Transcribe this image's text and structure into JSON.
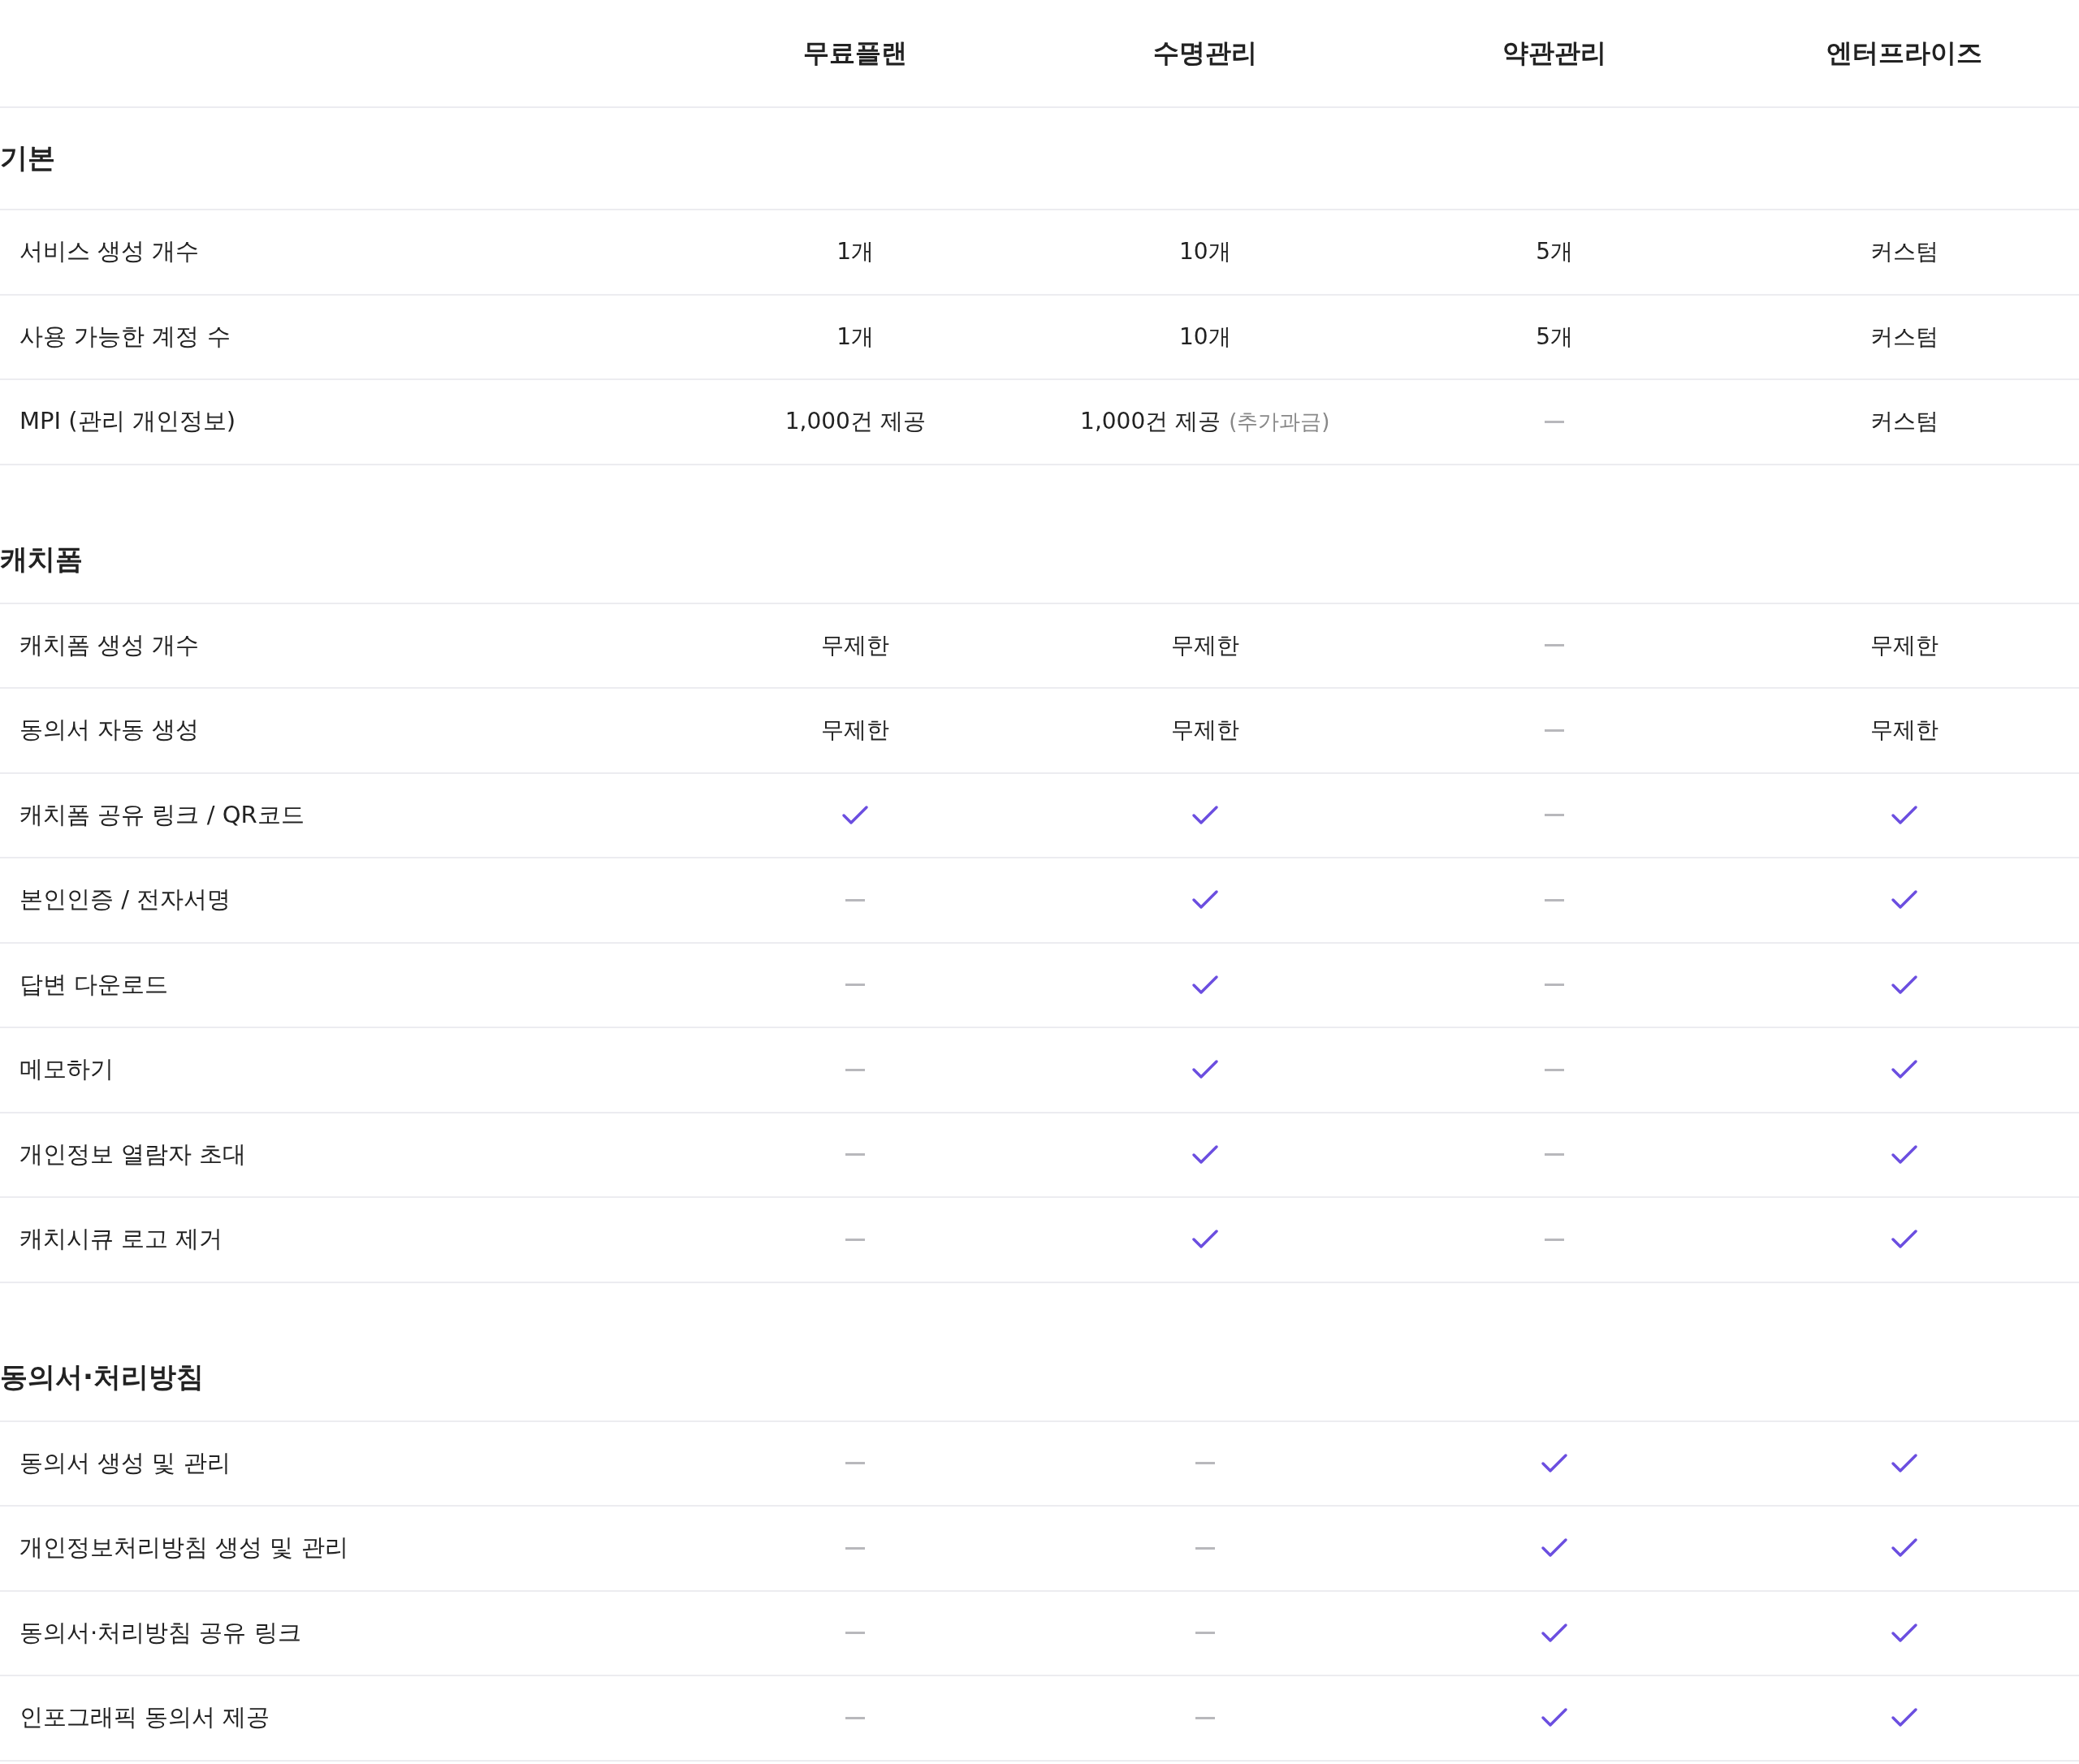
{
  "plans": [
    "무료플랜",
    "수명관리",
    "약관관리",
    "엔터프라이즈"
  ],
  "sections": [
    {
      "title": "기본",
      "rows": [
        {
          "label": "서비스 생성 개수",
          "cells": [
            {
              "kind": "text",
              "text": "1개"
            },
            {
              "kind": "text",
              "text": "10개"
            },
            {
              "kind": "text",
              "text": "5개"
            },
            {
              "kind": "text",
              "text": "커스텀"
            }
          ]
        },
        {
          "label": "사용 가능한 계정 수",
          "cells": [
            {
              "kind": "text",
              "text": "1개"
            },
            {
              "kind": "text",
              "text": "10개"
            },
            {
              "kind": "text",
              "text": "5개"
            },
            {
              "kind": "text",
              "text": "커스텀"
            }
          ]
        },
        {
          "label": "MPI (관리 개인정보)",
          "cells": [
            {
              "kind": "text",
              "text": "1,000건 제공"
            },
            {
              "kind": "text",
              "text": "1,000건 제공",
              "note": "(추가과금)"
            },
            {
              "kind": "dash"
            },
            {
              "kind": "text",
              "text": "커스텀"
            }
          ]
        }
      ]
    },
    {
      "title": "캐치폼",
      "rows": [
        {
          "label": "캐치폼 생성 개수",
          "cells": [
            {
              "kind": "text",
              "text": "무제한"
            },
            {
              "kind": "text",
              "text": "무제한"
            },
            {
              "kind": "dash"
            },
            {
              "kind": "text",
              "text": "무제한"
            }
          ]
        },
        {
          "label": "동의서 자동 생성",
          "cells": [
            {
              "kind": "text",
              "text": "무제한"
            },
            {
              "kind": "text",
              "text": "무제한"
            },
            {
              "kind": "dash"
            },
            {
              "kind": "text",
              "text": "무제한"
            }
          ]
        },
        {
          "label": "캐치폼 공유 링크 / QR코드",
          "cells": [
            {
              "kind": "check"
            },
            {
              "kind": "check"
            },
            {
              "kind": "dash"
            },
            {
              "kind": "check"
            }
          ]
        },
        {
          "label": "본인인증 / 전자서명",
          "cells": [
            {
              "kind": "dash"
            },
            {
              "kind": "check"
            },
            {
              "kind": "dash"
            },
            {
              "kind": "check"
            }
          ]
        },
        {
          "label": "답변 다운로드",
          "cells": [
            {
              "kind": "dash"
            },
            {
              "kind": "check"
            },
            {
              "kind": "dash"
            },
            {
              "kind": "check"
            }
          ]
        },
        {
          "label": "메모하기",
          "cells": [
            {
              "kind": "dash"
            },
            {
              "kind": "check"
            },
            {
              "kind": "dash"
            },
            {
              "kind": "check"
            }
          ]
        },
        {
          "label": "개인정보 열람자 초대",
          "cells": [
            {
              "kind": "dash"
            },
            {
              "kind": "check"
            },
            {
              "kind": "dash"
            },
            {
              "kind": "check"
            }
          ]
        },
        {
          "label": "캐치시큐 로고 제거",
          "cells": [
            {
              "kind": "dash"
            },
            {
              "kind": "check"
            },
            {
              "kind": "dash"
            },
            {
              "kind": "check"
            }
          ]
        }
      ]
    },
    {
      "title": "동의서·처리방침",
      "rows": [
        {
          "label": "동의서 생성 및 관리",
          "cells": [
            {
              "kind": "dash"
            },
            {
              "kind": "dash"
            },
            {
              "kind": "check"
            },
            {
              "kind": "check"
            }
          ]
        },
        {
          "label": "개인정보처리방침 생성 및 관리",
          "cells": [
            {
              "kind": "dash"
            },
            {
              "kind": "dash"
            },
            {
              "kind": "check"
            },
            {
              "kind": "check"
            }
          ]
        },
        {
          "label": "동의서·처리방침 공유 링크",
          "cells": [
            {
              "kind": "dash"
            },
            {
              "kind": "dash"
            },
            {
              "kind": "check"
            },
            {
              "kind": "check"
            }
          ]
        },
        {
          "label": "인포그래픽 동의서 제공",
          "cells": [
            {
              "kind": "dash"
            },
            {
              "kind": "dash"
            },
            {
              "kind": "check"
            },
            {
              "kind": "check"
            }
          ]
        }
      ]
    }
  ]
}
